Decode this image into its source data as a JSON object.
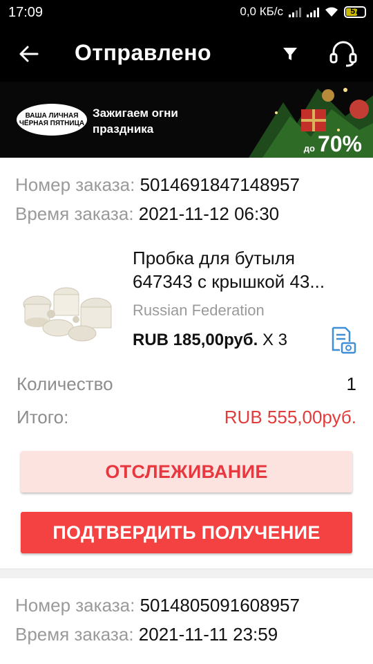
{
  "status_bar": {
    "time": "17:09",
    "network_speed": "0,0 КБ/с",
    "battery_level": "57"
  },
  "header": {
    "title": "Отправлено",
    "back_icon": "arrow-left-icon",
    "filter_icon": "filter-icon",
    "support_icon": "headset-icon"
  },
  "banner": {
    "logo_line1": "ВАША ЛИЧНАЯ",
    "logo_line2": "ЧЁРНАЯ ПЯТНИЦА",
    "tagline": "Зажигаем огни праздника",
    "discount_prefix": "до",
    "discount": "70%"
  },
  "orders": [
    {
      "number_label": "Номер заказа:",
      "number": "5014691847148957",
      "time_label": "Время заказа:",
      "time": "2021-11-12 06:30",
      "product": {
        "name": "Пробка для бутыля 647343 с крышкой 43...",
        "country": "Russian Federation",
        "price": "RUB 185,00руб.",
        "multiplier": "X 3"
      },
      "quantity_label": "Количество",
      "quantity": "1",
      "total_label": "Итого:",
      "total": "RUB 555,00руб.",
      "track_button": "ОТСЛЕЖИВАНИЕ",
      "confirm_button": "ПОДТВЕРДИТЬ ПОЛУЧЕНИЕ"
    },
    {
      "number_label": "Номер заказа:",
      "number": "5014805091608957",
      "time_label": "Время заказа:",
      "time": "2021-11-11 23:59"
    }
  ],
  "colors": {
    "accent_red": "#f44141",
    "track_bg": "#fde3e0",
    "total_red": "#e23b3b",
    "icon_blue": "#3f8ed6"
  }
}
